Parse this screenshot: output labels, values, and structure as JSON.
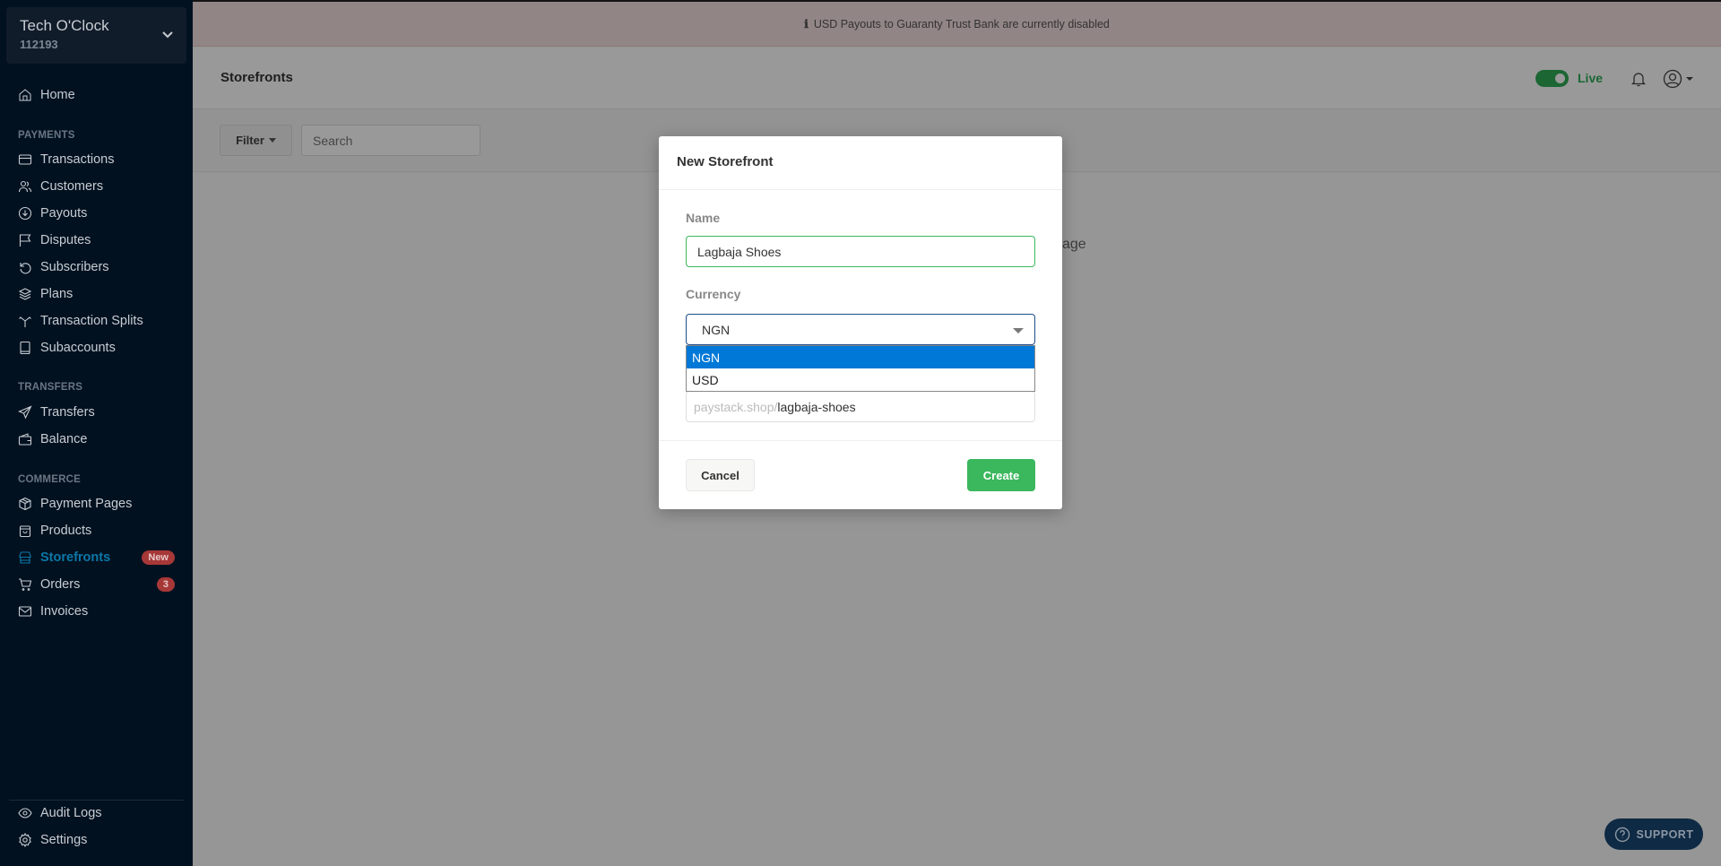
{
  "account": {
    "name": "Tech O'Clock",
    "id": "112193"
  },
  "sidebar": {
    "home": "Home",
    "sections": {
      "payments": "PAYMENTS",
      "transfers": "TRANSFERS",
      "commerce": "COMMERCE"
    },
    "items": [
      {
        "label": "Transactions",
        "icon": "credit-card-icon"
      },
      {
        "label": "Customers",
        "icon": "users-icon"
      },
      {
        "label": "Payouts",
        "icon": "arrow-down-circle-icon"
      },
      {
        "label": "Disputes",
        "icon": "flag-icon"
      },
      {
        "label": "Subscribers",
        "icon": "refresh-icon"
      },
      {
        "label": "Plans",
        "icon": "layers-icon"
      },
      {
        "label": "Transaction Splits",
        "icon": "split-icon"
      },
      {
        "label": "Subaccounts",
        "icon": "book-icon"
      },
      {
        "label": "Transfers",
        "icon": "send-icon"
      },
      {
        "label": "Balance",
        "icon": "wallet-icon"
      },
      {
        "label": "Payment Pages",
        "icon": "box-icon"
      },
      {
        "label": "Products",
        "icon": "bag-icon"
      },
      {
        "label": "Storefronts",
        "icon": "store-icon",
        "badge": "New",
        "active": true
      },
      {
        "label": "Orders",
        "icon": "cart-icon",
        "badge": "3"
      },
      {
        "label": "Invoices",
        "icon": "mail-icon"
      },
      {
        "label": "Audit Logs",
        "icon": "eye-icon"
      },
      {
        "label": "Settings",
        "icon": "gear-icon"
      }
    ]
  },
  "banner": {
    "text": "USD Payouts to Guaranty Trust Bank are currently disabled",
    "icon": "info-icon"
  },
  "header": {
    "title": "Storefronts",
    "mode_label": "Live",
    "live": true
  },
  "toolbar": {
    "filter_label": "Filter",
    "search_placeholder": "Search"
  },
  "background_text": "age",
  "support_label": "SUPPORT",
  "modal": {
    "title": "New Storefront",
    "name_label": "Name",
    "name_value": "Lagbaja Shoes",
    "currency_label": "Currency",
    "currency_value": "NGN",
    "currency_options": [
      "NGN",
      "USD"
    ],
    "url_prefix": "paystack.shop/",
    "url_slug": "lagbaja-shoes",
    "cancel_label": "Cancel",
    "create_label": "Create"
  },
  "colors": {
    "accent_green": "#3bb75e",
    "sidebar_bg": "#011120",
    "active_blue": "#0b78a8",
    "badge_red": "#a73838",
    "option_highlight": "#0078d7"
  }
}
